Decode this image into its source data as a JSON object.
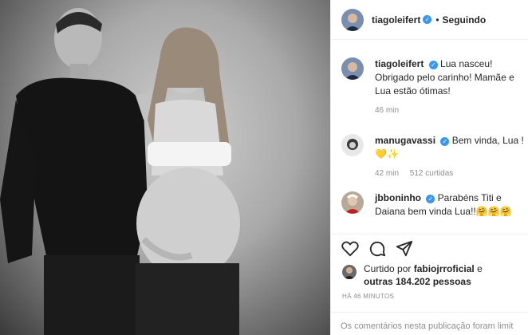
{
  "post": {
    "author": "tiagoleifert",
    "follow_label": "Seguindo",
    "dot": "•"
  },
  "comments": [
    {
      "user": "tiagoleifert",
      "text": "Lua nasceu! Obrigado pelo carinho! Mamãe e Lua estão ótimas!",
      "time": "46 min",
      "likes": ""
    },
    {
      "user": "manugavassi",
      "text": "Bem vinda, Lua !",
      "emoji": "💛✨",
      "time": "42 min",
      "likes": "512 curtidas"
    },
    {
      "user": "jbboninho",
      "text": "Parabéns Titi e Daiana bem vinda Lua!!🤗🤗🤗",
      "time": "",
      "likes": ""
    }
  ],
  "actions": {
    "like_icon": "heart-icon",
    "comment_icon": "comment-icon",
    "share_icon": "share-icon"
  },
  "liked_by": {
    "prefix": "Curtido por",
    "user": "fabiojrroficial",
    "suffix_e": "e",
    "others": "outras 184.202 pessoas"
  },
  "timestamp": "HÁ 46 MINUTOS",
  "footer": "Os comentários nesta publicação foram limit",
  "colors": {
    "verified": "#3897f0",
    "muted": "#8e8e8e",
    "text": "#262626",
    "border": "#efefef"
  }
}
